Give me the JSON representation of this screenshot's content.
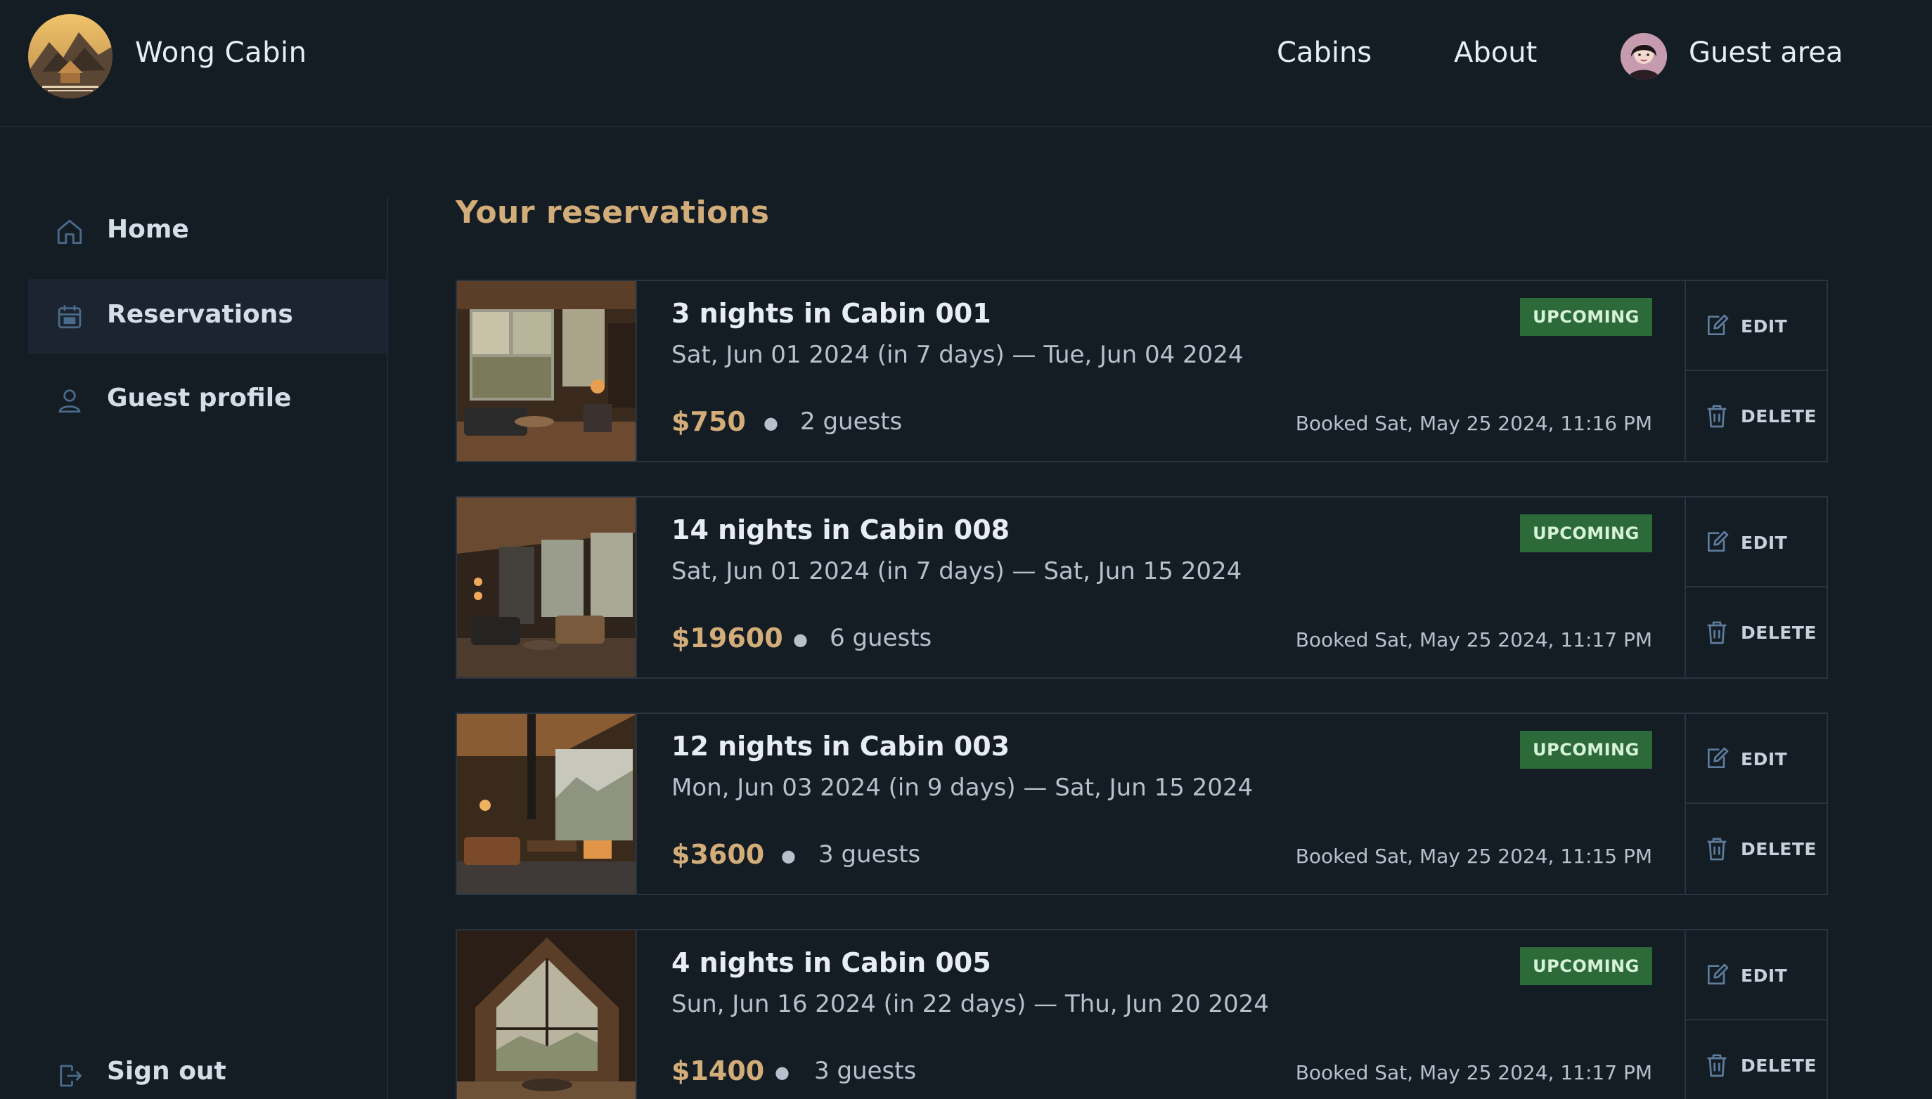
{
  "header": {
    "brand": "Wong Cabin",
    "nav": {
      "cabins": "Cabins",
      "about": "About",
      "guest_area": "Guest area"
    }
  },
  "sidebar": {
    "items": [
      {
        "label": "Home",
        "icon": "home-icon"
      },
      {
        "label": "Reservations",
        "icon": "calendar-icon",
        "active": true
      },
      {
        "label": "Guest profile",
        "icon": "user-icon"
      }
    ],
    "sign_out": "Sign out"
  },
  "main": {
    "title": "Your reservations",
    "actions": {
      "edit": "EDIT",
      "delete": "DELETE"
    },
    "reservations": [
      {
        "title": "3 nights in Cabin 001",
        "dates": "Sat, Jun 01 2024 (in 7 days) — Tue, Jun 04 2024",
        "price": "$750",
        "guests": "2 guests",
        "status": "UPCOMING",
        "booked": "Booked Sat, May 25 2024, 11:16 PM"
      },
      {
        "title": "14 nights in Cabin 008",
        "dates": "Sat, Jun 01 2024 (in 7 days) — Sat, Jun 15 2024",
        "price": "$19600",
        "guests": "6 guests",
        "status": "UPCOMING",
        "booked": "Booked Sat, May 25 2024, 11:17 PM"
      },
      {
        "title": "12 nights in Cabin 003",
        "dates": "Mon, Jun 03 2024 (in 9 days) — Sat, Jun 15 2024",
        "price": "$3600",
        "guests": "3 guests",
        "status": "UPCOMING",
        "booked": "Booked Sat, May 25 2024, 11:15 PM"
      },
      {
        "title": "4 nights in Cabin 005",
        "dates": "Sun, Jun 16 2024 (in 22 days) — Thu, Jun 20 2024",
        "price": "$1400",
        "guests": "3 guests",
        "status": "UPCOMING",
        "booked": "Booked Sat, May 25 2024, 11:17 PM"
      }
    ]
  },
  "colors": {
    "background": "#141c24",
    "accent": "#d2ad79",
    "badge": "#2c6a3a",
    "border": "#2a3441"
  }
}
